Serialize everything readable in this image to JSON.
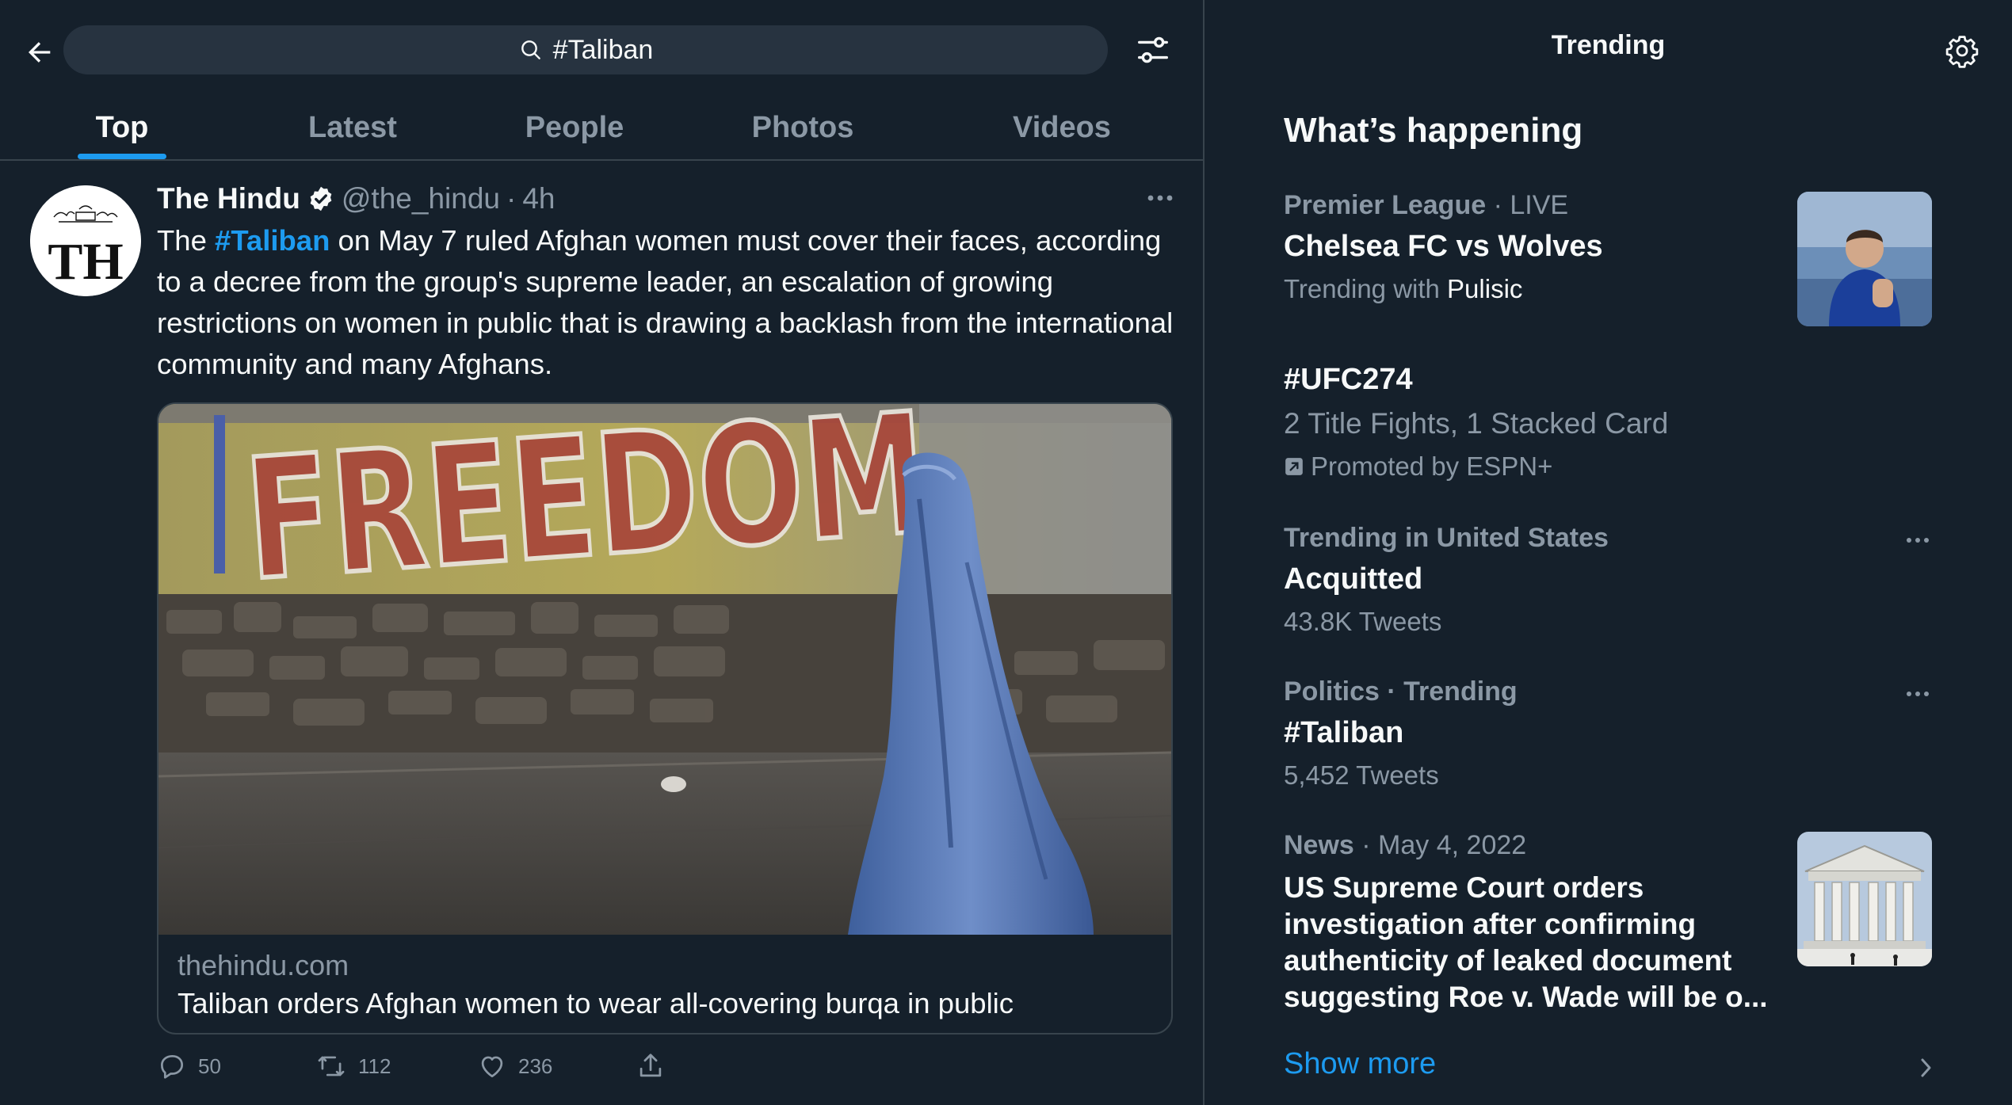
{
  "search": {
    "query": "#Taliban"
  },
  "tabs": [
    {
      "label": "Top",
      "active": true
    },
    {
      "label": "Latest",
      "active": false
    },
    {
      "label": "People",
      "active": false
    },
    {
      "label": "Photos",
      "active": false
    },
    {
      "label": "Videos",
      "active": false
    }
  ],
  "tweet": {
    "author_name": "The Hindu",
    "author_handle": "@the_hindu",
    "separator": "·",
    "time": "4h",
    "avatar_text": "TH",
    "text_before": "The ",
    "hashtag": "#Taliban",
    "text_after": " on May 7 ruled Afghan women must cover their faces, according to a decree from the group's supreme leader, an escalation of growing restrictions on women in public that is drawing a backlash from the international community and many Afghans.",
    "card": {
      "graffiti_text": "FREEDOM",
      "domain": "thehindu.com",
      "title": "Taliban orders Afghan women to wear all-covering burqa in public"
    },
    "stats": {
      "replies": "50",
      "retweets": "112",
      "likes": "236"
    }
  },
  "sidebar": {
    "header": "Trending",
    "section_title": "What’s happening",
    "items": [
      {
        "category": "Premier League",
        "live": "· LIVE",
        "title": "Chelsea FC vs Wolves",
        "sub_prefix": "Trending with ",
        "sub_highlight": "Pulisic"
      },
      {
        "title": "#UFC274",
        "sub": "2 Title Fights, 1 Stacked Card",
        "promoted": "Promoted by ESPN+"
      },
      {
        "category": "Trending in United States",
        "title": "Acquitted",
        "sub": "43.8K Tweets"
      },
      {
        "category": "Politics · Trending",
        "title": "#Taliban",
        "sub": "5,452 Tweets"
      },
      {
        "category": "News",
        "date": "· May 4, 2022",
        "title_lines": [
          "US Supreme Court orders",
          "investigation after confirming",
          "authenticity of leaked document",
          "suggesting Roe v. Wade will be o..."
        ]
      }
    ],
    "show_more": "Show more"
  },
  "colors": {
    "background": "#15202b",
    "accent": "#1d9bf0",
    "muted": "#8b98a5",
    "border": "#38444d"
  }
}
